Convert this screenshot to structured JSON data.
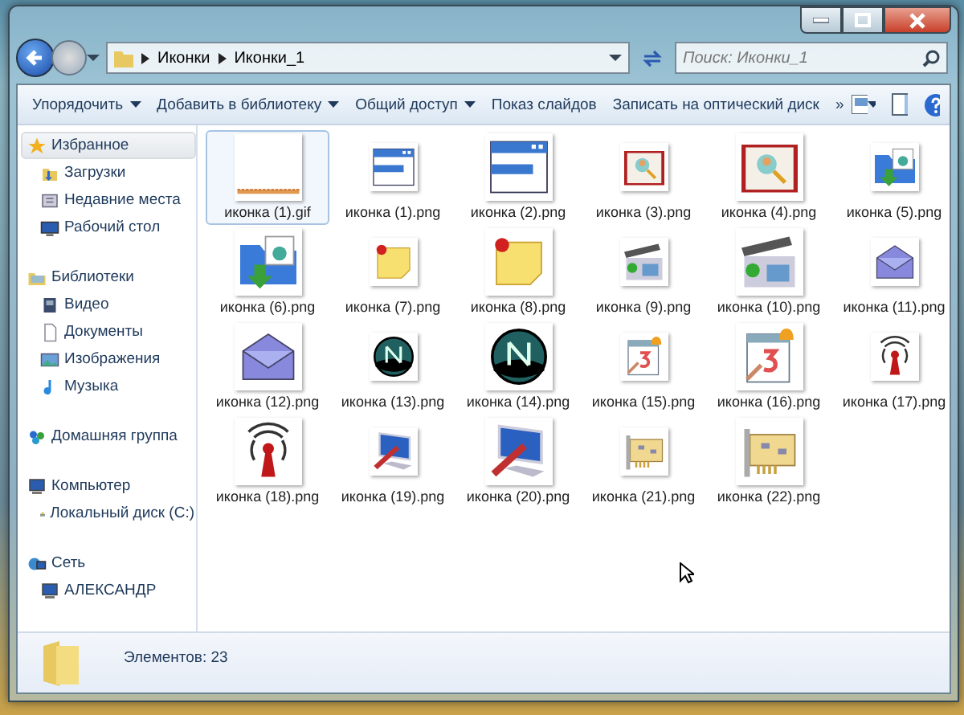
{
  "address": {
    "path": [
      "Иконки",
      "Иконки_1"
    ]
  },
  "search": {
    "placeholder": "Поиск: Иконки_1"
  },
  "toolbar": {
    "buttons": [
      {
        "label": "Упорядочить",
        "menu": true
      },
      {
        "label": "Добавить в библиотеку",
        "menu": true
      },
      {
        "label": "Общий доступ",
        "menu": true
      },
      {
        "label": "Показ слайдов",
        "menu": false
      },
      {
        "label": "Записать на оптический диск",
        "menu": false
      }
    ],
    "overflow": "»"
  },
  "sidebar": {
    "groups": [
      {
        "label": "Избранное",
        "kind": "star",
        "selected": true,
        "children": [
          {
            "label": "Загрузки",
            "kind": "download",
            "selected": false
          },
          {
            "label": "Недавние места",
            "kind": "recent",
            "selected": false
          },
          {
            "label": "Рабочий стол",
            "kind": "desktop",
            "selected": false
          }
        ]
      },
      {
        "label": "Библиотеки",
        "kind": "library",
        "selected": false,
        "children": [
          {
            "label": "Видео",
            "kind": "video",
            "selected": false
          },
          {
            "label": "Документы",
            "kind": "document",
            "selected": false
          },
          {
            "label": "Изображения",
            "kind": "image",
            "selected": false
          },
          {
            "label": "Музыка",
            "kind": "music",
            "selected": false
          }
        ]
      },
      {
        "label": "Домашняя группа",
        "kind": "homegroup",
        "selected": false
      },
      {
        "label": "Компьютер",
        "kind": "computer",
        "selected": false,
        "children": [
          {
            "label": "Локальный диск (C:)",
            "kind": "drive",
            "selected": false
          }
        ]
      },
      {
        "label": "Сеть",
        "kind": "network",
        "selected": false,
        "children": [
          {
            "label": "АЛЕКСАНДР",
            "kind": "computer",
            "selected": false
          }
        ]
      }
    ]
  },
  "files": [
    {
      "name": "иконка (1).gif",
      "kind": "strip",
      "large": true,
      "selected": true
    },
    {
      "name": "иконка (1).png",
      "kind": "window",
      "large": false,
      "selected": false
    },
    {
      "name": "иконка (2).png",
      "kind": "window",
      "large": true,
      "selected": false
    },
    {
      "name": "иконка (3).png",
      "kind": "book",
      "large": false,
      "selected": false
    },
    {
      "name": "иконка (4).png",
      "kind": "book",
      "large": true,
      "selected": false
    },
    {
      "name": "иконка (5).png",
      "kind": "folder",
      "large": false,
      "selected": false
    },
    {
      "name": "иконка (6).png",
      "kind": "folder",
      "large": true,
      "selected": false
    },
    {
      "name": "иконка (7).png",
      "kind": "note",
      "large": false,
      "selected": false
    },
    {
      "name": "иконка (8).png",
      "kind": "note",
      "large": true,
      "selected": false
    },
    {
      "name": "иконка (9).png",
      "kind": "film",
      "large": false,
      "selected": false
    },
    {
      "name": "иконка (10).png",
      "kind": "film",
      "large": true,
      "selected": false
    },
    {
      "name": "иконка (11).png",
      "kind": "envelope",
      "large": false,
      "selected": false
    },
    {
      "name": "иконка (12).png",
      "kind": "envelope",
      "large": true,
      "selected": false
    },
    {
      "name": "иконка (13).png",
      "kind": "globe",
      "large": false,
      "selected": false
    },
    {
      "name": "иконка (14).png",
      "kind": "globe",
      "large": true,
      "selected": false
    },
    {
      "name": "иконка (15).png",
      "kind": "calendar",
      "large": false,
      "selected": false
    },
    {
      "name": "иконка (16).png",
      "kind": "calendar",
      "large": true,
      "selected": false
    },
    {
      "name": "иконка (17).png",
      "kind": "antenna",
      "large": false,
      "selected": false
    },
    {
      "name": "иконка (18).png",
      "kind": "antenna",
      "large": true,
      "selected": false
    },
    {
      "name": "иконка (19).png",
      "kind": "tools",
      "large": false,
      "selected": false
    },
    {
      "name": "иконка (20).png",
      "kind": "tools",
      "large": true,
      "selected": false
    },
    {
      "name": "иконка (21).png",
      "kind": "board",
      "large": false,
      "selected": false
    },
    {
      "name": "иконка (22).png",
      "kind": "board",
      "large": true,
      "selected": false
    }
  ],
  "status_bar": {
    "text": "Элементов: 23"
  }
}
